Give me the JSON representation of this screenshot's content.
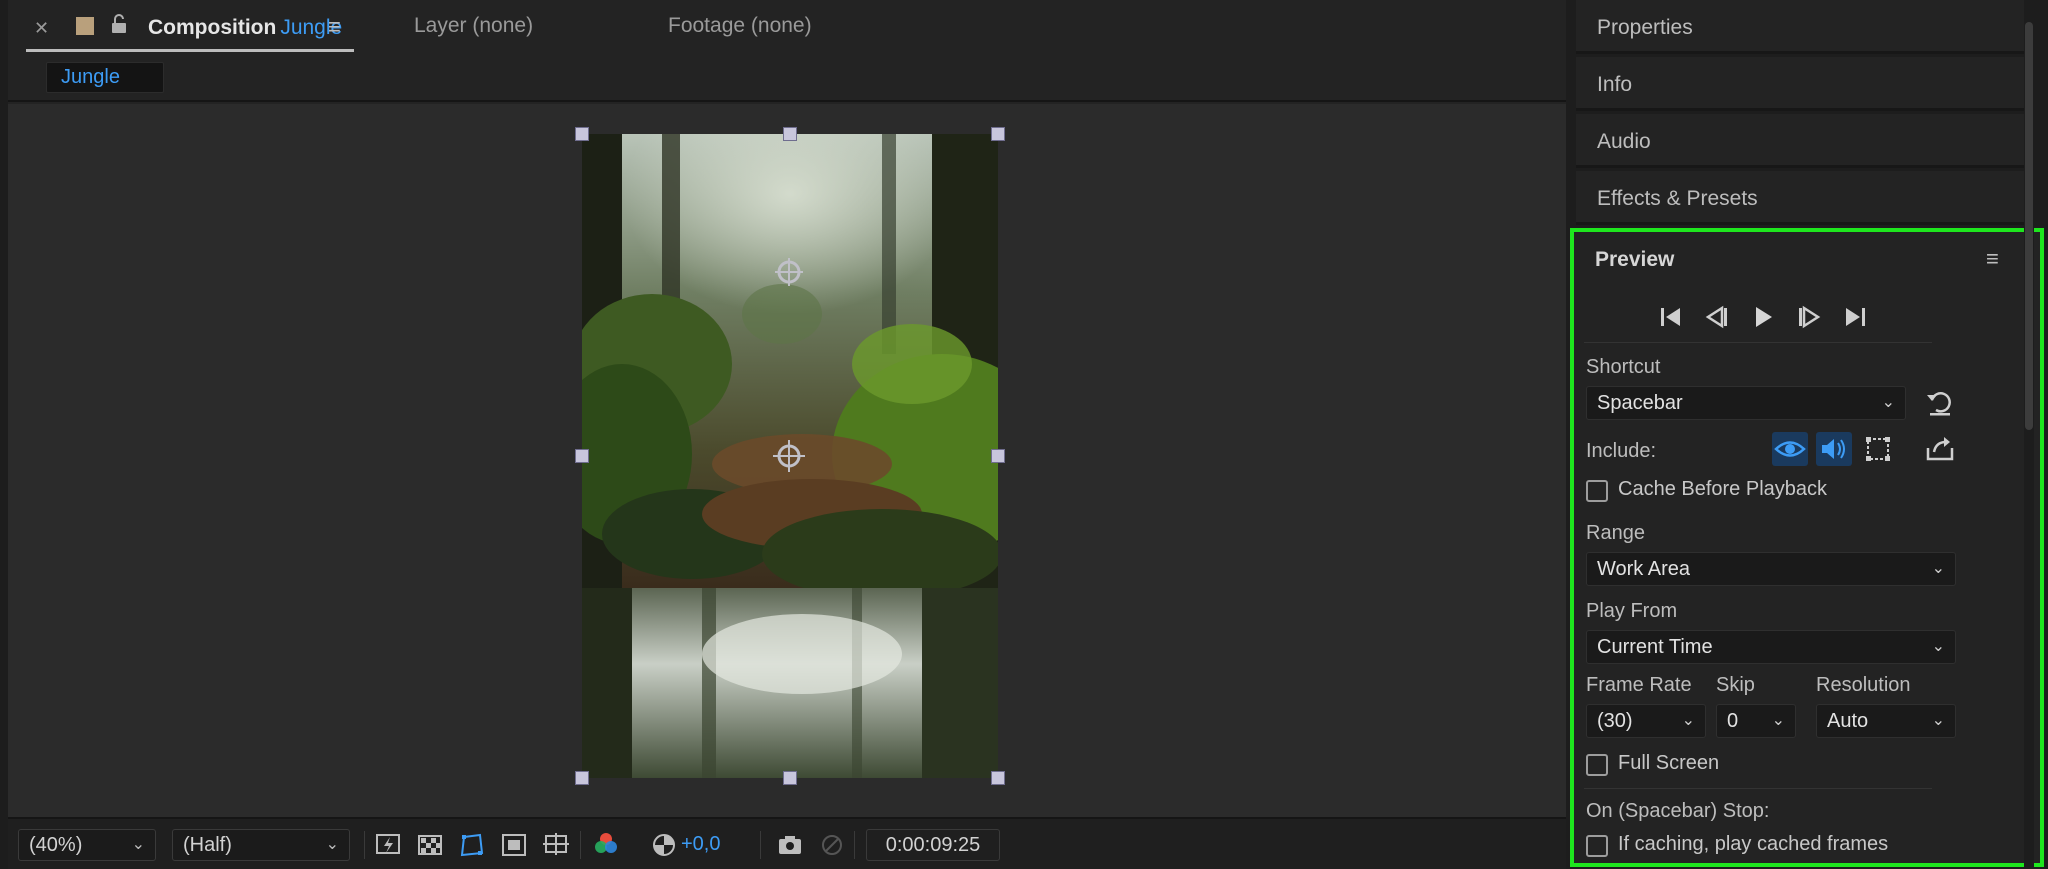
{
  "composition_panel": {
    "tabs": {
      "composition": {
        "prefix": "Composition",
        "name": "Jungle"
      },
      "layer": "Layer (none)",
      "footage": "Footage (none)"
    },
    "comp_chip": "Jungle",
    "toolbar": {
      "zoom": "(40%)",
      "resolution": "(Half)",
      "exposure": "+0,0",
      "timecode": "0:00:09:25"
    }
  },
  "right_panels": {
    "collapsed": [
      "Properties",
      "Info",
      "Audio",
      "Effects & Presets"
    ],
    "preview": {
      "title": "Preview",
      "transport_icons": [
        "first-frame-icon",
        "previous-frame-icon",
        "play-icon",
        "next-frame-icon",
        "last-frame-icon"
      ],
      "shortcut_label": "Shortcut",
      "shortcut_value": "Spacebar",
      "include_label": "Include:",
      "include_video": true,
      "include_audio": true,
      "include_overlays": false,
      "cache_before_playback": {
        "label": "Cache Before Playback",
        "checked": false
      },
      "range_label": "Range",
      "range_value": "Work Area",
      "play_from_label": "Play From",
      "play_from_value": "Current Time",
      "frame_rate_label": "Frame Rate",
      "frame_rate_value": "(30)",
      "skip_label": "Skip",
      "skip_value": "0",
      "resolution_label": "Resolution",
      "resolution_value": "Auto",
      "full_screen": {
        "label": "Full Screen",
        "checked": false
      },
      "on_stop_label": "On (Spacebar) Stop:",
      "if_caching": {
        "label": "If caching, play cached frames",
        "checked": false
      }
    }
  },
  "colors": {
    "accent_blue": "#3d9cf5",
    "highlight_green": "#1ee61e",
    "label_swatch": "#b9a07c"
  }
}
